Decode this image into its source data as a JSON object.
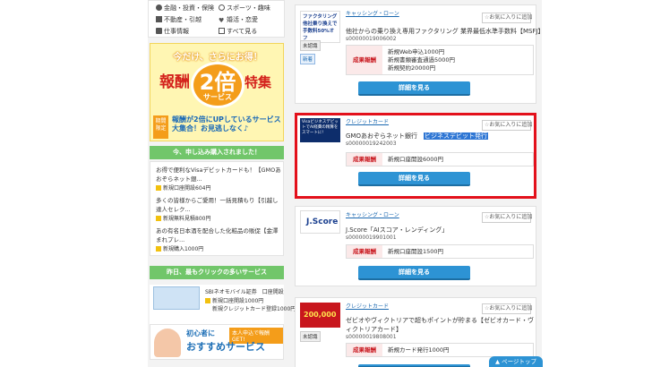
{
  "sidebar": {
    "categories": [
      {
        "label": "金融・投資・保険",
        "icon": "yen-icon"
      },
      {
        "label": "スポーツ・趣味",
        "icon": "sports-icon"
      },
      {
        "label": "不動産・引越",
        "icon": "house-icon"
      },
      {
        "label": "婚活・恋愛",
        "icon": "heart-icon"
      },
      {
        "label": "仕事情報",
        "icon": "briefcase-icon"
      },
      {
        "label": "すべて見る",
        "icon": "all-icon"
      }
    ],
    "banner": {
      "top": "今だけ、さらにお得！",
      "left": "報酬",
      "big": "2倍",
      "sub": "サービス",
      "right": "特集",
      "badge": "期間限定",
      "desc": "報酬が2倍にUPしているサービス大集合！お見逃しなく♪"
    },
    "recent_head": "今、申し込み購入されました！",
    "recent": [
      {
        "text": "お得で便利なVisaデビットカードも！【GMOあおぞらネット銀...",
        "pt": "新規口座開設604円"
      },
      {
        "text": "多くの皆様からご愛用！一括見積もり【引越し達人セレク...",
        "pt": "新規無料見積800円"
      },
      {
        "text": "あの有名日本酒を配合した化粧品の販促【金澤まれプレ...",
        "pt": "新規購入1000円"
      }
    ],
    "click_head": "昨日、最もクリックの多いサービス",
    "click_item": {
      "name": "SBIネオモバイル証券　口座開設",
      "pt1": "新規口座開設1000円",
      "pt2": "新規クレジットカード登録1000円"
    },
    "promo": {
      "line1": "初心者に",
      "badge": "本人申込で報酬GET!",
      "line2": "おすすめサービス"
    }
  },
  "cards": [
    {
      "category": "キャッシング・ローン",
      "fav": "お気に入りに追加",
      "title": "他社からの乗り換え専用ファクタリング 業界最低水準手数料【MSFJ】",
      "id": "s00000019006002",
      "tags": [
        "未認識",
        "新着"
      ],
      "reward_label": "成果報酬",
      "rewards": [
        "新規Web申込1000円",
        "新規書類審査通過5000円",
        "新規契約20000円"
      ],
      "button": "詳細を見る",
      "img_text": "ファクタリング 他社乗り換えで 手数料50%オフ"
    },
    {
      "category": "クレジットカード",
      "fav": "お気に入りに追加",
      "title": "GMOあおぞらネット銀行",
      "title_sel": "ビジネスデビット発行",
      "id": "s00000019242003",
      "reward_label": "成果報酬",
      "rewards": [
        "新規口座開設6000円"
      ],
      "button": "詳細を見る",
      "img_text": "VisaビジネスデビットでAI経費の精算をスマートに!"
    },
    {
      "category": "キャッシング・ローン",
      "fav": "お気に入りに追加",
      "title": "J.Score「AIスコア・レンディング」",
      "id": "s00000019901001",
      "reward_label": "成果報酬",
      "rewards": [
        "新規口座開設1500円"
      ],
      "button": "詳細を見る",
      "img_text": "J.Score"
    },
    {
      "category": "クレジットカード",
      "fav": "お気に入りに追加",
      "title": "ゼビオやヴィクトリアで超もポイントが貯まる【ゼビオカード・ヴィクトリアカード】",
      "id": "s00000019808001",
      "tags": [
        "未認識"
      ],
      "reward_label": "成果報酬",
      "rewards": [
        "新規カード発行1000円"
      ],
      "img_text": "200,000"
    }
  ],
  "pagetop": "▲ ページトップ",
  "colors": {
    "accent": "#2d93d4",
    "highlight": "#e3101b",
    "green": "#71c66a",
    "reward": "#c8161d"
  }
}
